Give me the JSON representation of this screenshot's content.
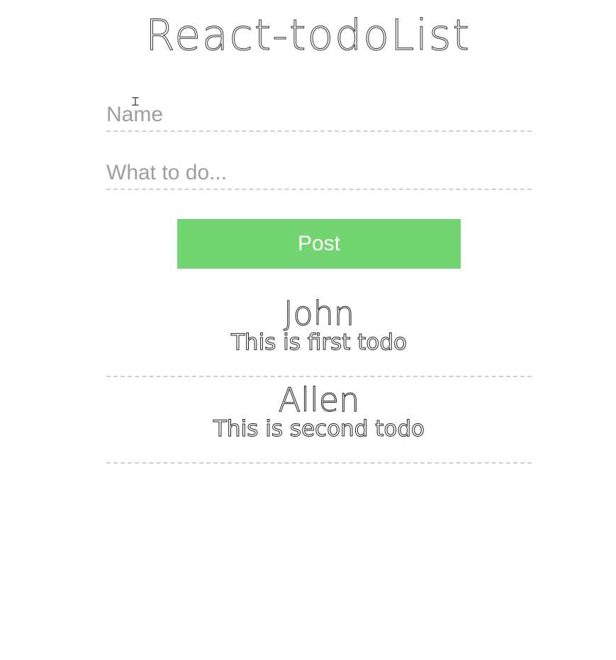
{
  "app": {
    "title": "React-todoList"
  },
  "form": {
    "name_placeholder": "Name",
    "name_value": "",
    "todo_placeholder": "What to do...",
    "todo_value": "",
    "post_label": "Post"
  },
  "todos": [
    {
      "name": "John",
      "text": "This is first todo"
    },
    {
      "name": "Allen",
      "text": "This is second todo"
    }
  ],
  "colors": {
    "post_button": "#72d572",
    "divider": "#cfcfcf",
    "placeholder": "#9e9e9e"
  }
}
